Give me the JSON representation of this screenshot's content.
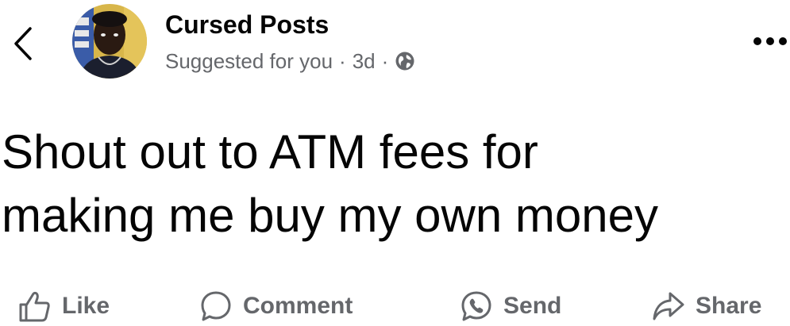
{
  "header": {
    "author": "Cursed Posts",
    "suggested": "Suggested for you",
    "separator": "·",
    "time": "3d",
    "icons": {
      "back": "chevron-left-icon",
      "audience": "globe-icon",
      "more": "more-options-icon"
    }
  },
  "post": {
    "lines": [
      "Shout out to ATM fees for",
      "making me buy my own money"
    ]
  },
  "actions": {
    "like": "Like",
    "comment": "Comment",
    "send": "Send",
    "share": "Share"
  },
  "colors": {
    "text": "#050505",
    "secondary": "#65676b",
    "background": "#ffffff"
  }
}
